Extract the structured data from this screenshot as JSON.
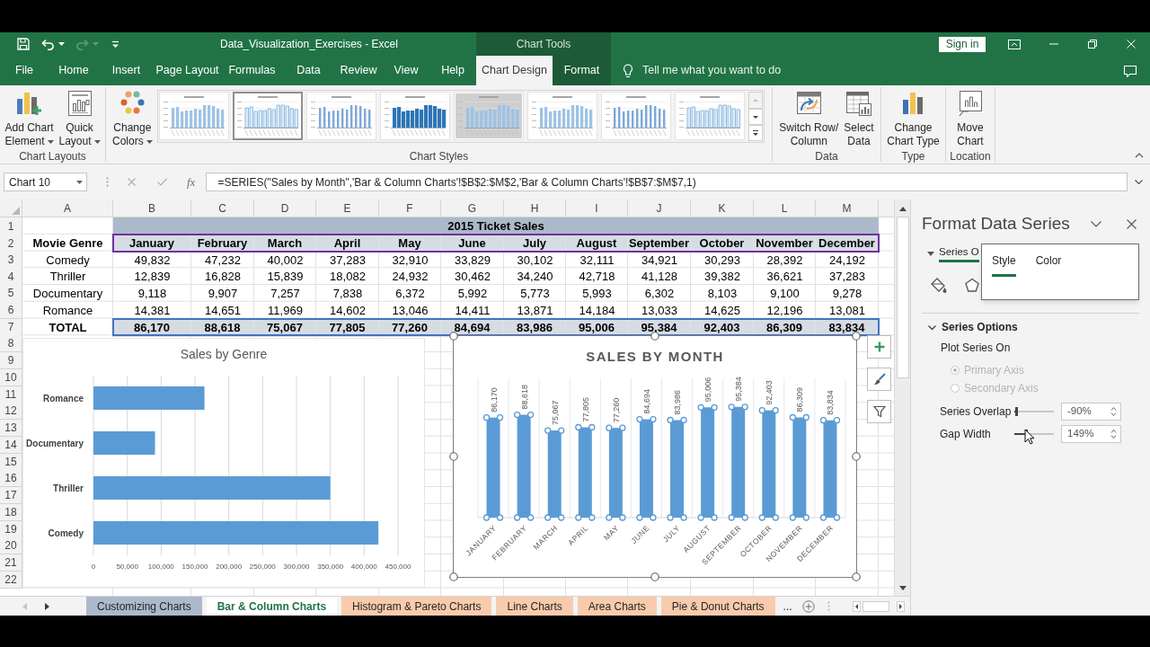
{
  "title_bar": {
    "title": "Data_Visualization_Exercises - Excel",
    "context_label": "Chart Tools",
    "sign_in": "Sign in"
  },
  "menu_tabs": [
    {
      "label": "File",
      "selected": false,
      "kind": "main"
    },
    {
      "label": "Home",
      "selected": false,
      "kind": "main"
    },
    {
      "label": "Insert",
      "selected": false,
      "kind": "main"
    },
    {
      "label": "Page Layout",
      "selected": false,
      "kind": "main"
    },
    {
      "label": "Formulas",
      "selected": false,
      "kind": "main"
    },
    {
      "label": "Data",
      "selected": false,
      "kind": "main"
    },
    {
      "label": "Review",
      "selected": false,
      "kind": "main"
    },
    {
      "label": "View",
      "selected": false,
      "kind": "main"
    },
    {
      "label": "Help",
      "selected": false,
      "kind": "main"
    },
    {
      "label": "Chart Design",
      "selected": true,
      "kind": "context"
    },
    {
      "label": "Format",
      "selected": false,
      "kind": "context"
    }
  ],
  "tell_me": {
    "placeholder": "Tell me what you want to do"
  },
  "ribbon": {
    "groups": [
      {
        "label": "Chart Layouts",
        "items": [
          {
            "kind": "button",
            "lines": [
              "Add Chart",
              "Element"
            ],
            "dropdown": true
          },
          {
            "kind": "button",
            "lines": [
              "Quick",
              "Layout"
            ],
            "dropdown": true
          }
        ]
      },
      {
        "label": "Chart Styles",
        "items": [
          {
            "kind": "button",
            "lines": [
              "Change",
              "Colors"
            ],
            "dropdown": true
          },
          {
            "kind": "gallery",
            "styles": [
              {
                "kind": "plain",
                "selected": false
              },
              {
                "kind": "outlined",
                "selected": true
              },
              {
                "kind": "thin",
                "selected": false
              },
              {
                "kind": "bold",
                "selected": false
              },
              {
                "kind": "shaded",
                "selected": false
              },
              {
                "kind": "plain",
                "selected": false
              },
              {
                "kind": "thin",
                "selected": false
              },
              {
                "kind": "outlined",
                "selected": false
              }
            ]
          }
        ]
      },
      {
        "label": "Data",
        "items": [
          {
            "kind": "button",
            "lines": [
              "Switch Row/",
              "Column"
            ],
            "dropdown": false
          },
          {
            "kind": "button",
            "lines": [
              "Select",
              "Data"
            ],
            "dropdown": false
          }
        ]
      },
      {
        "label": "Type",
        "items": [
          {
            "kind": "button",
            "lines": [
              "Change",
              "Chart Type"
            ],
            "dropdown": false
          }
        ]
      },
      {
        "label": "Location",
        "items": [
          {
            "kind": "button",
            "lines": [
              "Move",
              "Chart"
            ],
            "dropdown": false
          }
        ]
      }
    ]
  },
  "formula_bar": {
    "name_box": "Chart 10",
    "insert_function": "fx",
    "formula": "=SERIES(\"Sales by Month\",'Bar & Column Charts'!$B$2:$M$2,'Bar & Column Charts'!$B$7:$M$7,1)"
  },
  "sheet": {
    "columns": [
      "A",
      "B",
      "C",
      "D",
      "E",
      "F",
      "G",
      "H",
      "I",
      "J",
      "K",
      "L",
      "M"
    ],
    "rows": [
      {
        "header": "1",
        "kind": "title",
        "title": "2015 Ticket Sales"
      },
      {
        "header": "2",
        "kind": "head",
        "label": "Movie Genre",
        "cells": [
          "January",
          "February",
          "March",
          "April",
          "May",
          "June",
          "July",
          "August",
          "September",
          "October",
          "November",
          "December"
        ],
        "color": "#7030a0"
      },
      {
        "header": "3",
        "kind": "data",
        "label": "Comedy",
        "cells": [
          "49,832",
          "47,232",
          "40,002",
          "37,283",
          "32,910",
          "33,829",
          "30,102",
          "32,111",
          "34,921",
          "30,293",
          "28,392",
          "24,192"
        ]
      },
      {
        "header": "4",
        "kind": "data",
        "label": "Thriller",
        "cells": [
          "12,839",
          "16,828",
          "15,839",
          "18,082",
          "24,932",
          "30,462",
          "34,240",
          "42,718",
          "41,128",
          "39,382",
          "36,621",
          "37,283"
        ]
      },
      {
        "header": "5",
        "kind": "data",
        "label": "Documentary",
        "cells": [
          "9,118",
          "9,907",
          "7,257",
          "7,838",
          "6,372",
          "5,992",
          "5,773",
          "5,993",
          "6,302",
          "8,103",
          "9,100",
          "9,278"
        ]
      },
      {
        "header": "6",
        "kind": "data",
        "label": "Romance",
        "cells": [
          "14,381",
          "14,651",
          "11,969",
          "14,602",
          "13,046",
          "14,411",
          "13,871",
          "14,184",
          "13,033",
          "14,625",
          "12,196",
          "13,081"
        ]
      },
      {
        "header": "7",
        "kind": "total",
        "label": "TOTAL",
        "cells": [
          "86,170",
          "88,618",
          "75,067",
          "77,805",
          "77,260",
          "84,694",
          "83,986",
          "95,006",
          "95,384",
          "92,403",
          "86,309",
          "83,834"
        ],
        "color": "#4472c4"
      },
      {
        "header": "8",
        "kind": "empty"
      },
      {
        "header": "9",
        "kind": "empty"
      },
      {
        "header": "10",
        "kind": "empty"
      },
      {
        "header": "11",
        "kind": "empty"
      },
      {
        "header": "12",
        "kind": "empty"
      },
      {
        "header": "13",
        "kind": "empty"
      },
      {
        "header": "14",
        "kind": "empty"
      },
      {
        "header": "15",
        "kind": "empty"
      },
      {
        "header": "16",
        "kind": "empty"
      },
      {
        "header": "17",
        "kind": "empty"
      },
      {
        "header": "18",
        "kind": "empty"
      },
      {
        "header": "19",
        "kind": "empty"
      },
      {
        "header": "20",
        "kind": "empty"
      },
      {
        "header": "21",
        "kind": "empty"
      },
      {
        "header": "22",
        "kind": "empty"
      }
    ]
  },
  "charts": [
    {
      "selected": false,
      "chart_data": {
        "type": "bar",
        "orientation": "horizontal",
        "title": "Sales by Genre",
        "categories": [
          "Romance",
          "Documentary",
          "Thriller",
          "Comedy"
        ],
        "values": [
          164000,
          91000,
          350000,
          421000
        ],
        "xlim": [
          0,
          450000
        ],
        "xticks": [
          0,
          {
            "value": 50000,
            "label": "50,000"
          },
          {
            "value": 100000,
            "label": "100,000"
          },
          {
            "value": 150000,
            "label": "150,000"
          },
          {
            "value": 200000,
            "label": "200,000"
          },
          {
            "value": 250000,
            "label": "250,000"
          },
          {
            "value": 300000,
            "label": "300,000"
          },
          {
            "value": 350000,
            "label": "350,000"
          },
          {
            "value": 400000,
            "label": "400,000"
          },
          {
            "value": 450000,
            "label": "450,000"
          }
        ],
        "grid": true
      }
    },
    {
      "selected": true,
      "series_selected": true,
      "chart_data": {
        "type": "bar",
        "orientation": "vertical",
        "title": "SALES BY MONTH",
        "categories": [
          "JANUARY",
          "FEBRUARY",
          "MARCH",
          "APRIL",
          "MAY",
          "JUNE",
          "JULY",
          "AUGUST",
          "SEPTEMBER",
          "OCTOBER",
          "NOVEMBER",
          "DECEMBER"
        ],
        "values": [
          86170,
          88618,
          75067,
          77805,
          77260,
          84694,
          83986,
          95006,
          95384,
          92403,
          86309,
          83834
        ],
        "value_labels": [
          "86,170",
          "88,618",
          "75,067",
          "77,805",
          "77,260",
          "84,694",
          "83,986",
          "95,006",
          "95,384",
          "92,403",
          "86,309",
          "83,834"
        ],
        "grid": true
      }
    }
  ],
  "format_pane": {
    "title": "Format Data Series",
    "tabs": [
      {
        "label": "Series O",
        "selected": true
      }
    ],
    "popup_tabs": [
      {
        "label": "Style",
        "selected": true
      },
      {
        "label": "Color",
        "selected": false
      }
    ],
    "section": {
      "label": "Series Options",
      "expanded": true
    },
    "plot_series_on": "Plot Series On",
    "radios": [
      {
        "label": "Primary Axis",
        "selected": true,
        "disabled": true
      },
      {
        "label": "Secondary Axis",
        "selected": false,
        "disabled": true
      }
    ],
    "sliders": [
      {
        "label": "Series Overlap",
        "level": 0.05,
        "value": "-90%"
      },
      {
        "label": "Gap Width",
        "level": 0.3,
        "value": "149%"
      }
    ]
  },
  "sheet_tabs": {
    "tabs": [
      {
        "label": "Customizing Charts",
        "selected": false,
        "color": "#acb9ca"
      },
      {
        "label": "Bar & Column Charts",
        "selected": true
      },
      {
        "label": "Histogram & Pareto Charts",
        "selected": false,
        "color": "#f8cbad"
      },
      {
        "label": "Line Charts",
        "selected": false,
        "color": "#f8cbad"
      },
      {
        "label": "Area Charts",
        "selected": false,
        "color": "#f8cbad"
      },
      {
        "label": "Pie & Donut Charts",
        "selected": false,
        "color": "#f8cbad"
      }
    ],
    "overflow": "..."
  }
}
